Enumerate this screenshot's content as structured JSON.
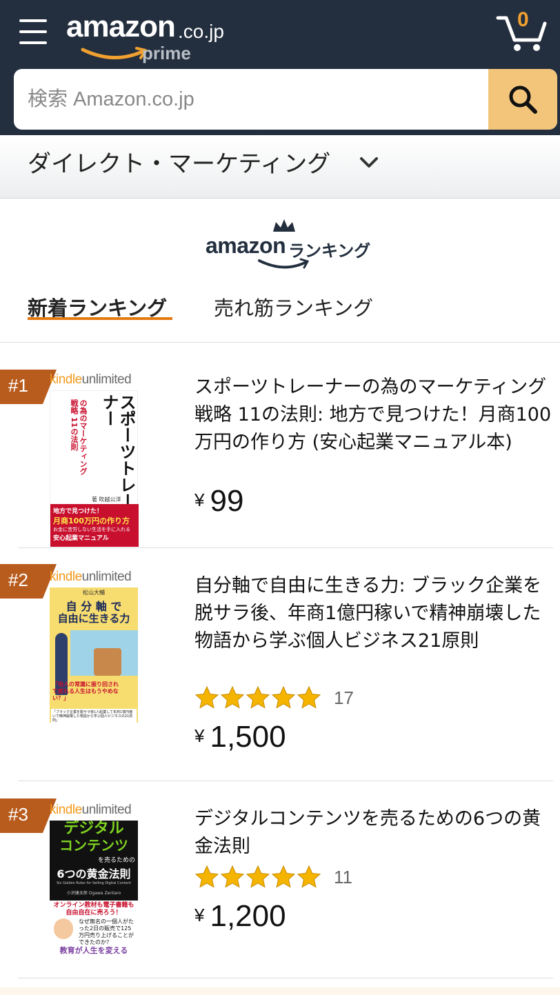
{
  "header": {
    "logo_word": "amazon",
    "logo_tld": ".co.jp",
    "logo_sub": "prime",
    "cart_count": "0"
  },
  "search": {
    "placeholder": "検索 Amazon.co.jp"
  },
  "category": {
    "label": "ダイレクト・マーケティング"
  },
  "ranking_logo": {
    "brand": "amazon",
    "label": "ランキング"
  },
  "tabs": [
    {
      "label": "新着ランキング",
      "active": true
    },
    {
      "label": "売れ筋ランキング",
      "active": false
    }
  ],
  "items": [
    {
      "rank": "#1",
      "kindle": "kindle",
      "unlimited": "unlimited",
      "title": "スポーツトレーナーの為のマーケティング戦略 11の法則: 地方で見つけた！月商100万円の作り方 (安心起業マニュアル本)",
      "yen": "¥",
      "price": "99",
      "cover": {
        "main": "スポーツトレーナー",
        "sub": "の為のマーケティング戦略 11の法則",
        "author": "著 吹越公洋",
        "band1": "地方で見つけた！",
        "band2": "月商100万円の作り方",
        "band3": "お金に苦労しない生活を手に入れる",
        "band4": "安心起業マニュアル"
      }
    },
    {
      "rank": "#2",
      "kindle": "kindle",
      "unlimited": "unlimited",
      "title": "自分軸で自由に生きる力: ブラック企業を脱サラ後、年商1億円稼いで精神崩壊した物語から学ぶ個人ビジネス21原則",
      "rating": 5,
      "review_count": "17",
      "yen": "¥",
      "price": "1,500",
      "cover": {
        "author": "松山大輔",
        "line1": "自 分 軸 で",
        "line2": "自由に生きる力",
        "quote": "「他人の常識に振り回されて疲れる人生はもうやめない？」",
        "foot": "「ブラック企業を脱サラ後1人起業して年商1億円稼いで精神崩壊した物語から学ぶ個人ビジネスの21原則」"
      }
    },
    {
      "rank": "#3",
      "kindle": "kindle",
      "unlimited": "unlimited",
      "title": "デジタルコンテンツを売るための6つの黄金法則",
      "rating": 5,
      "review_count": "11",
      "yen": "¥",
      "price": "1,200",
      "cover": {
        "line1": "デジタル",
        "line2": "コンテンツ",
        "line3": "を売るための",
        "line4": "6つの黄金法則",
        "en": "Six Golden Rules for Selling Digital Content",
        "author": "小沢康太郎 Ogawa Zentaro",
        "promo": "オンライン教材も電子書籍も自由自在に売ろう！",
        "q": "なぜ無名の一個人がたった2日の販売で125万円売り上げることができたのか？",
        "bottom": "教育が人生を変える"
      }
    }
  ],
  "colors": {
    "header_bg": "#232f3e",
    "search_button": "#f3c57a",
    "accent": "#e47911",
    "rank_badge": "#b85c1e",
    "star": "#f4b400"
  }
}
